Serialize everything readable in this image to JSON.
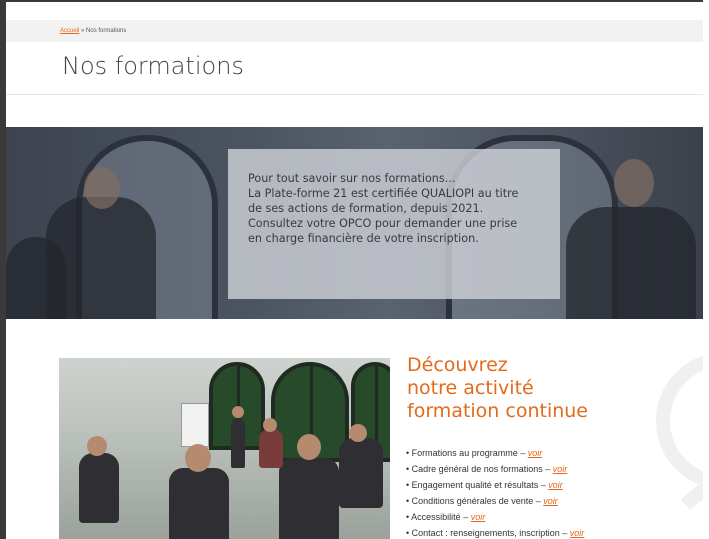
{
  "breadcrumb": {
    "home": "Accueil",
    "separator": "»",
    "current": "Nos formations"
  },
  "page": {
    "title": "Nos formations"
  },
  "hero": {
    "lines": [
      "Pour tout savoir sur nos formations...",
      "La Plate-forme 21 est certifiée QUALIOPI au titre",
      "de ses actions de formation, depuis 2021.",
      "Consultez votre OPCO pour demander une prise",
      "en charge financière de votre inscription."
    ]
  },
  "section": {
    "heading_lines": [
      "Découvrez",
      "notre activité",
      "formation continue"
    ],
    "links": [
      {
        "bullet": "•",
        "text": "Formations au programme –",
        "link": "voir"
      },
      {
        "bullet": "•",
        "text": "Cadre général de nos formations –",
        "link": "voir"
      },
      {
        "bullet": "•",
        "text": "Engagement qualité et résultats –",
        "link": "voir"
      },
      {
        "bullet": "•",
        "text": "Conditions générales de vente –",
        "link": "voir"
      },
      {
        "bullet": "•",
        "text": "Accessibilité –",
        "link": "voir"
      },
      {
        "bullet": "•",
        "text": "Contact : renseignements, inscription –",
        "link": "voir"
      }
    ]
  },
  "colors": {
    "accent": "#e36a1a",
    "text": "#333333",
    "breadcrumb_bg": "#f2f2f2"
  }
}
